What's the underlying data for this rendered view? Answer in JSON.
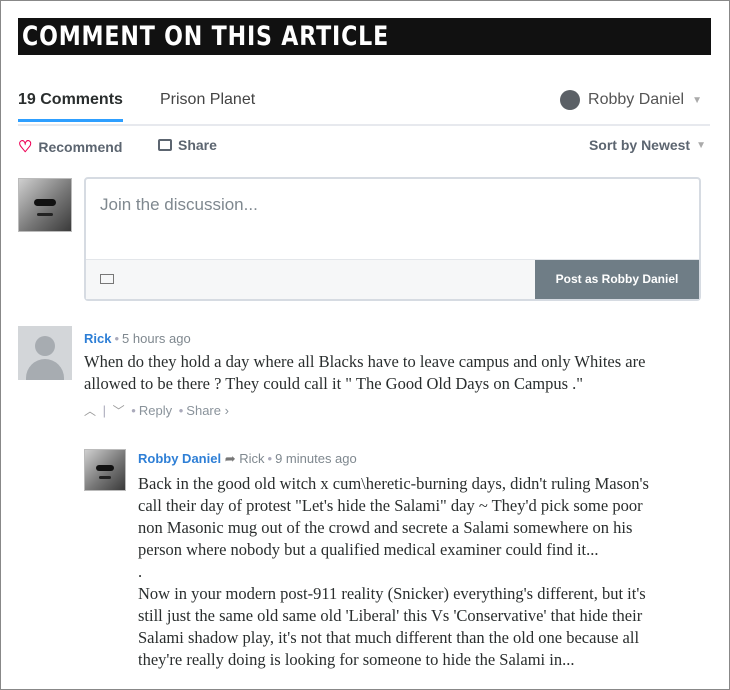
{
  "banner": {
    "title": "COMMENT ON THIS ARTICLE"
  },
  "nav": {
    "comments_tab": "19 Comments",
    "site_tab": "Prison Planet",
    "user_name": "Robby Daniel"
  },
  "actions": {
    "recommend": "Recommend",
    "share": "Share",
    "sort": "Sort by Newest"
  },
  "composer": {
    "placeholder": "Join the discussion...",
    "post_button": "Post as Robby Daniel"
  },
  "comments": [
    {
      "author": "Rick",
      "time": "5 hours ago",
      "lines": [
        "When do they hold a day where all Blacks have to leave campus and only Whites are",
        "allowed to be there ? They could call it \" The Good Old Days on Campus .\""
      ],
      "reply": "Reply",
      "share": "Share ›"
    },
    {
      "author": "Robby Daniel",
      "reply_to": "Rick",
      "time": "9 minutes ago",
      "lines": [
        "Back in the good old witch x cum\\heretic-burning days, didn't ruling Mason's",
        "call their day of protest \"Let's hide the Salami\" day ~ They'd pick some poor",
        "non Masonic mug out of the crowd and secrete a Salami somewhere on his",
        "person where nobody but a qualified medical examiner could find it...",
        ".",
        "Now in your modern post-911 reality (Snicker) everything's different, but it's",
        "still just the same old same old 'Liberal' this Vs 'Conservative' that hide their",
        "Salami shadow play, it's not that much different than the old one because all",
        "they're really doing is looking for someone to hide the Salami in..."
      ]
    }
  ],
  "colors": {
    "accent": "#2e9fff",
    "author": "#2e7fd6",
    "post_button": "#6f7d86"
  }
}
